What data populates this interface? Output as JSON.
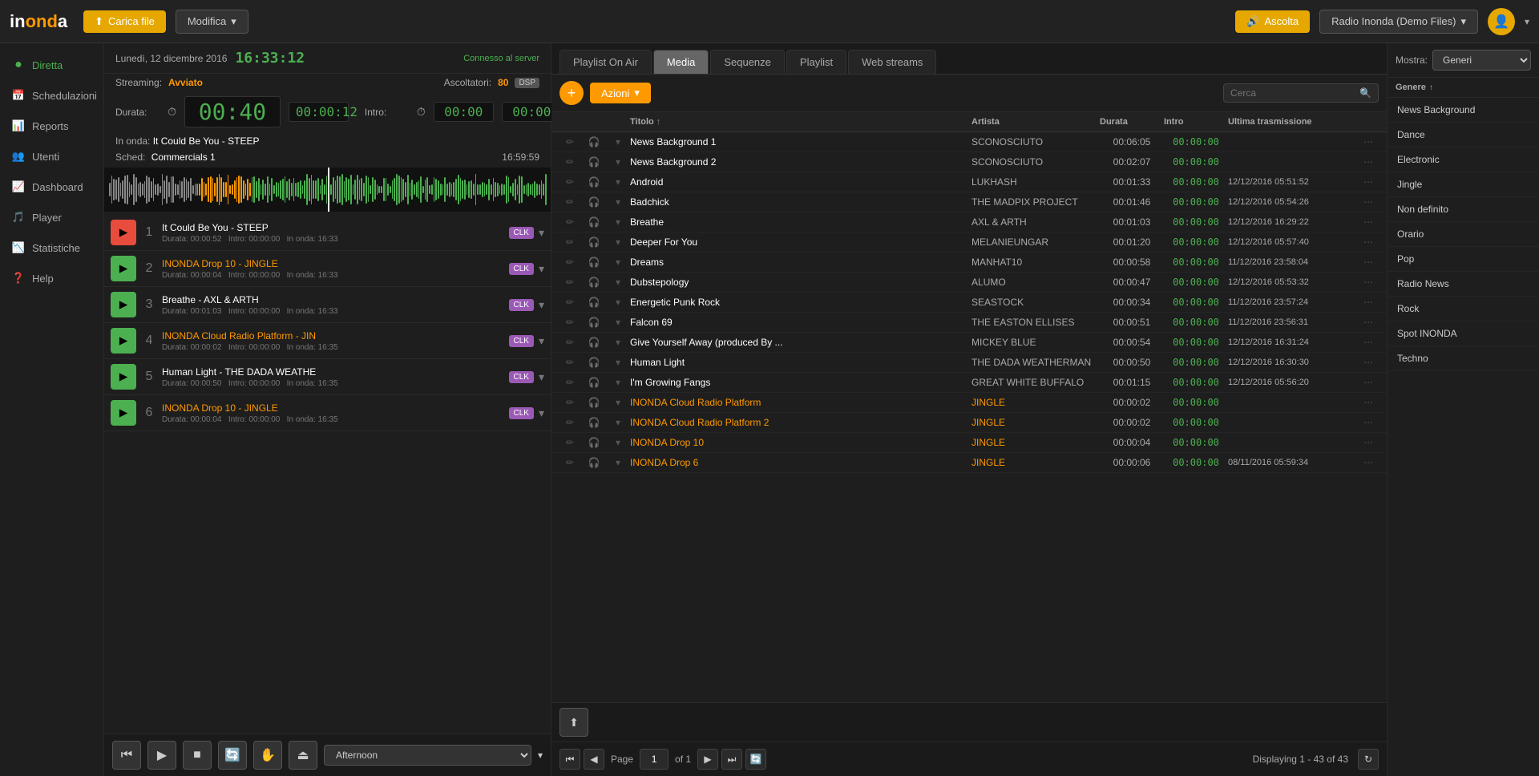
{
  "app": {
    "logo": "inonda",
    "upload_btn": "Carica file",
    "modifica_btn": "Modifica",
    "ascolta_btn": "Ascolta",
    "radio_name": "Radio Inonda (Demo Files)"
  },
  "sidebar": {
    "items": [
      {
        "label": "Diretta",
        "icon": "▶",
        "active": true
      },
      {
        "label": "Schedulazioni",
        "icon": "📅",
        "active": false
      },
      {
        "label": "Reports",
        "icon": "📊",
        "active": false
      },
      {
        "label": "Utenti",
        "icon": "👤",
        "active": false
      },
      {
        "label": "Dashboard",
        "icon": "📈",
        "active": false
      },
      {
        "label": "Player",
        "icon": "🎵",
        "active": false
      },
      {
        "label": "Statistiche",
        "icon": "📉",
        "active": false
      },
      {
        "label": "Help",
        "icon": "❓",
        "active": false
      }
    ]
  },
  "left_panel": {
    "date": "Lunedì, 12 dicembre 2016",
    "time": "16:33:12",
    "connected": "Connesso al server",
    "streaming_label": "Streaming:",
    "streaming_val": "Avviato",
    "listeners_label": "Ascoltatori:",
    "listeners_val": "80",
    "dsp": "DSP",
    "dur_label": "Durata:",
    "dur_val": "00:40",
    "dur_small": "00:00:12",
    "intro_label": "Intro:",
    "intro_val": "00:00",
    "in_onda_label": "In onda:",
    "in_onda_val": "It Could Be You - STEEP",
    "sched_label": "Sched:",
    "sched_val": "Commercials 1",
    "sched_time": "16:59:59",
    "playlist": [
      {
        "num": "1",
        "title": "It Could Be You - STEEP",
        "dur": "00:00:52",
        "intro": "00:00:00",
        "on_air": "16:33",
        "jingle": false,
        "playing": true
      },
      {
        "num": "2",
        "title": "INONDA Drop 10 - JINGLE",
        "dur": "00:00:04",
        "intro": "00:00:00",
        "on_air": "16:33",
        "jingle": true,
        "playing": false
      },
      {
        "num": "3",
        "title": "Breathe - AXL & ARTH",
        "dur": "00:01:03",
        "intro": "00:00:00",
        "on_air": "16:33",
        "jingle": false,
        "playing": false
      },
      {
        "num": "4",
        "title": "INONDA Cloud Radio Platform - JIN",
        "dur": "00:00:02",
        "intro": "00:00:00",
        "on_air": "16:35",
        "jingle": true,
        "playing": false
      },
      {
        "num": "5",
        "title": "Human Light - THE DADA WEATHE",
        "dur": "00:00:50",
        "intro": "00:00:00",
        "on_air": "16:35",
        "jingle": false,
        "playing": false
      },
      {
        "num": "6",
        "title": "INONDA Drop 10 - JINGLE",
        "dur": "00:00:04",
        "intro": "00:00:00",
        "on_air": "16:35",
        "jingle": true,
        "playing": false
      }
    ],
    "transport": {
      "schedule_val": "Afternoon"
    }
  },
  "tabs": [
    "Playlist On Air",
    "Media",
    "Sequenze",
    "Playlist",
    "Web streams"
  ],
  "active_tab": "Media",
  "toolbar": {
    "azioni": "Azioni",
    "search_placeholder": "Cerca"
  },
  "table": {
    "columns": [
      "",
      "",
      "",
      "Titolo",
      "Artista",
      "Durata",
      "Intro",
      "Ultima trasmissione",
      ""
    ],
    "rows": [
      {
        "title": "News Background 1",
        "artist": "SCONOSCIUTO",
        "dur": "00:06:05",
        "intro": "00:00:00",
        "last": "",
        "jingle": false
      },
      {
        "title": "News Background 2",
        "artist": "SCONOSCIUTO",
        "dur": "00:02:07",
        "intro": "00:00:00",
        "last": "",
        "jingle": false
      },
      {
        "title": "Android",
        "artist": "LUKHASH",
        "dur": "00:01:33",
        "intro": "00:00:00",
        "last": "12/12/2016 05:51:52",
        "jingle": false
      },
      {
        "title": "Badchick",
        "artist": "THE MADPIX PROJECT",
        "dur": "00:01:46",
        "intro": "00:00:00",
        "last": "12/12/2016 05:54:26",
        "jingle": false
      },
      {
        "title": "Breathe",
        "artist": "AXL & ARTH",
        "dur": "00:01:03",
        "intro": "00:00:00",
        "last": "12/12/2016 16:29:22",
        "jingle": false
      },
      {
        "title": "Deeper For You",
        "artist": "MELANIEUNGAR",
        "dur": "00:01:20",
        "intro": "00:00:00",
        "last": "12/12/2016 05:57:40",
        "jingle": false
      },
      {
        "title": "Dreams",
        "artist": "MANHAT10",
        "dur": "00:00:58",
        "intro": "00:00:00",
        "last": "11/12/2016 23:58:04",
        "jingle": false
      },
      {
        "title": "Dubstepology",
        "artist": "ALUMO",
        "dur": "00:00:47",
        "intro": "00:00:00",
        "last": "12/12/2016 05:53:32",
        "jingle": false
      },
      {
        "title": "Energetic Punk Rock",
        "artist": "SEASTOCK",
        "dur": "00:00:34",
        "intro": "00:00:00",
        "last": "11/12/2016 23:57:24",
        "jingle": false
      },
      {
        "title": "Falcon 69",
        "artist": "THE EASTON ELLISES",
        "dur": "00:00:51",
        "intro": "00:00:00",
        "last": "11/12/2016 23:56:31",
        "jingle": false
      },
      {
        "title": "Give Yourself Away (produced By ...",
        "artist": "MICKEY BLUE",
        "dur": "00:00:54",
        "intro": "00:00:00",
        "last": "12/12/2016 16:31:24",
        "jingle": false
      },
      {
        "title": "Human Light",
        "artist": "THE DADA WEATHERMAN",
        "dur": "00:00:50",
        "intro": "00:00:00",
        "last": "12/12/2016 16:30:30",
        "jingle": false
      },
      {
        "title": "I'm Growing Fangs",
        "artist": "GREAT WHITE BUFFALO",
        "dur": "00:01:15",
        "intro": "00:00:00",
        "last": "12/12/2016 05:56:20",
        "jingle": false
      },
      {
        "title": "INONDA Cloud Radio Platform",
        "artist": "JINGLE",
        "dur": "00:00:02",
        "intro": "00:00:00",
        "last": "",
        "jingle": true
      },
      {
        "title": "INONDA Cloud Radio Platform 2",
        "artist": "JINGLE",
        "dur": "00:00:02",
        "intro": "00:00:00",
        "last": "",
        "jingle": true
      },
      {
        "title": "INONDA Drop 10",
        "artist": "JINGLE",
        "dur": "00:00:04",
        "intro": "00:00:00",
        "last": "",
        "jingle": true
      },
      {
        "title": "INONDA Drop 6",
        "artist": "JINGLE",
        "dur": "00:00:06",
        "intro": "00:00:00",
        "last": "08/11/2016 05:59:34",
        "jingle": true
      }
    ]
  },
  "pagination": {
    "page_label": "Page",
    "page_current": "1",
    "page_of": "of 1",
    "display_info": "Displaying 1 - 43 of 43"
  },
  "right_panel": {
    "show_label": "Mostra:",
    "show_val": "Generi",
    "genre_header": "Genere",
    "genres": [
      "News Background",
      "Dance",
      "Electronic",
      "Jingle",
      "Non definito",
      "Orario",
      "Pop",
      "Radio News",
      "Rock",
      "Spot INONDA",
      "Techno"
    ]
  }
}
